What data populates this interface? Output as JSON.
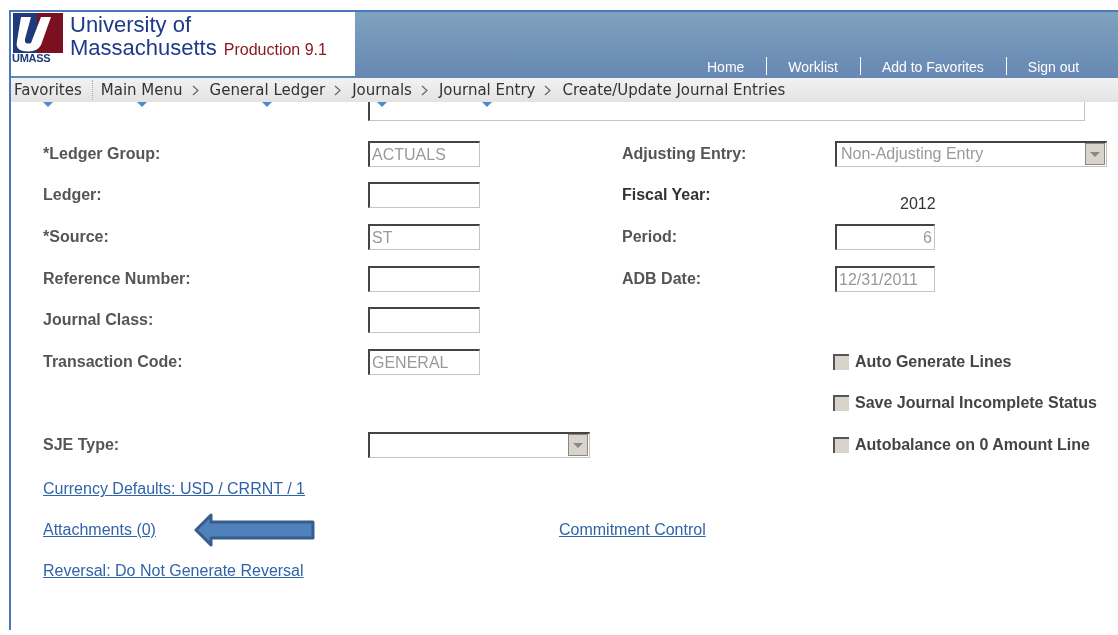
{
  "header": {
    "logo_mark": "UMASS",
    "title_line1": "University of",
    "title_line2": "Massachusetts",
    "environment": "Production 9.1",
    "links": [
      "Home",
      "Worklist",
      "Add to Favorites",
      "Sign out"
    ]
  },
  "breadcrumbs": [
    {
      "label": "Favorites",
      "kind": "menu"
    },
    {
      "label": "Main Menu",
      "kind": "menu"
    },
    {
      "label": "General Ledger",
      "kind": "menu"
    },
    {
      "label": "Journals",
      "kind": "menu"
    },
    {
      "label": "Journal Entry",
      "kind": "menu"
    },
    {
      "label": "Create/Update Journal Entries",
      "kind": "page"
    }
  ],
  "rows": [
    {
      "left": {
        "label": "*Ledger Group:",
        "kind": "input",
        "value": "ACTUALS"
      },
      "right": {
        "label": "Adjusting Entry:",
        "kind": "select",
        "value": "Non-Adjusting Entry"
      }
    },
    {
      "left": {
        "label": "Ledger:",
        "kind": "input"
      },
      "right": {
        "label": "Fiscal Year:",
        "kind": "display",
        "value": "2012"
      }
    },
    {
      "left": {
        "label": "*Source:",
        "kind": "input",
        "value": "ST"
      },
      "right": {
        "label": "Period:",
        "kind": "number",
        "value": "6"
      }
    },
    {
      "left": {
        "label": "Reference Number:",
        "kind": "input"
      },
      "right": {
        "label": "ADB Date:",
        "kind": "input",
        "value": "12/31/2011"
      }
    },
    {
      "left": {
        "label": "Journal Class:",
        "kind": "input"
      }
    },
    {
      "left": {
        "label": "Transaction Code:",
        "kind": "input",
        "value": "GENERAL"
      },
      "right": {
        "label": "Auto Generate Lines",
        "kind": "checkbox",
        "checked": false
      }
    },
    {
      "right": {
        "label": "Save Journal Incomplete Status",
        "kind": "checkbox",
        "checked": false
      }
    },
    {
      "left": {
        "label": "SJE Type:",
        "kind": "select"
      },
      "right": {
        "label": "Autobalance on 0 Amount Line",
        "kind": "checkbox",
        "checked": false
      }
    }
  ],
  "links": [
    {
      "left": "Currency Defaults: USD / CRRNT / 1"
    },
    {
      "left": "Attachments (0)",
      "right": "Commitment Control",
      "pointer": true
    },
    {
      "left": "Reversal: Do Not Generate Reversal"
    }
  ]
}
